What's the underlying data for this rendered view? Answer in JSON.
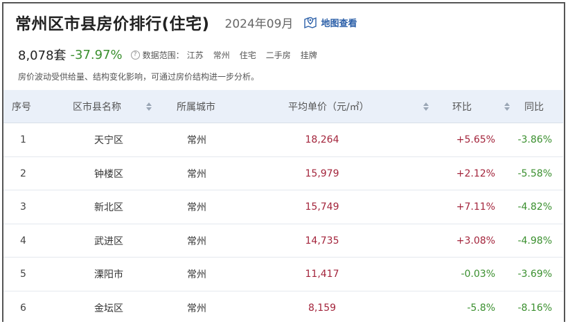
{
  "header": {
    "title": "常州区市县房价排行(住宅)",
    "date": "2024年09月",
    "map_label": "地图查看"
  },
  "stats": {
    "count": "8,078套",
    "change": "-37.97%",
    "help_glyph": "?",
    "range_label": "数据范围：",
    "range_items": [
      "江苏",
      "常州",
      "住宅",
      "二手房",
      "挂牌"
    ]
  },
  "note": "房价波动受供给量、结构变化影响，可通过房价结构进一步分析。",
  "table": {
    "columns": [
      "序号",
      "区市县名称",
      "所属城市",
      "平均单价（元/㎡）",
      "环比",
      "同比"
    ],
    "rows": [
      {
        "index": "1",
        "name": "天宁区",
        "city": "常州",
        "price": "18,264",
        "mom": "+5.65%",
        "yoy": "-3.86%"
      },
      {
        "index": "2",
        "name": "钟楼区",
        "city": "常州",
        "price": "15,979",
        "mom": "+2.12%",
        "yoy": "-5.58%"
      },
      {
        "index": "3",
        "name": "新北区",
        "city": "常州",
        "price": "15,749",
        "mom": "+7.11%",
        "yoy": "-4.82%"
      },
      {
        "index": "4",
        "name": "武进区",
        "city": "常州",
        "price": "14,735",
        "mom": "+3.08%",
        "yoy": "-4.98%"
      },
      {
        "index": "5",
        "name": "溧阳市",
        "city": "常州",
        "price": "11,417",
        "mom": "-0.03%",
        "yoy": "-3.69%"
      },
      {
        "index": "6",
        "name": "金坛区",
        "city": "常州",
        "price": "8,159",
        "mom": "-5.8%",
        "yoy": "-8.16%"
      }
    ]
  },
  "colors": {
    "up": "#a3243b",
    "down": "#3a8f2e",
    "header_bg": "#eaf0f9",
    "link": "#2b5fa8"
  }
}
